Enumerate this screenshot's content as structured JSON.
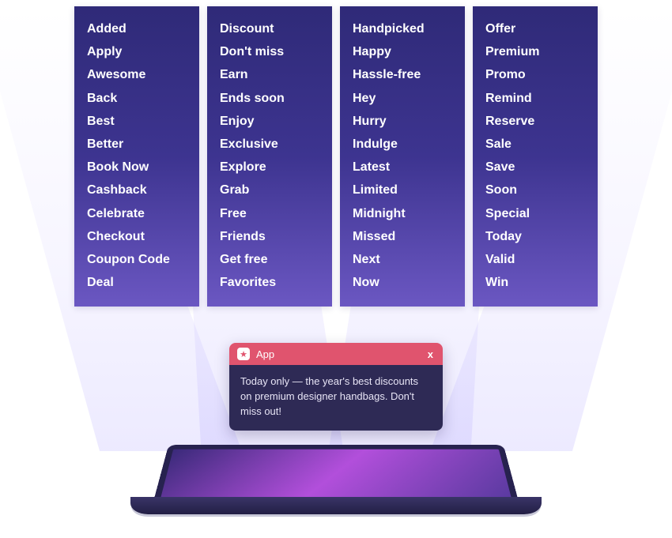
{
  "columns": [
    {
      "words": [
        "Added",
        "Apply",
        "Awesome",
        "Back",
        "Best",
        "Better",
        "Book Now",
        "Cashback",
        "Celebrate",
        "Checkout",
        "Coupon Code",
        "Deal"
      ]
    },
    {
      "words": [
        "Discount",
        "Don't miss",
        "Earn",
        "Ends soon",
        "Enjoy",
        "Exclusive",
        "Explore",
        "Grab",
        "Free",
        "Friends",
        "Get free",
        "Favorites"
      ]
    },
    {
      "words": [
        "Handpicked",
        "Happy",
        "Hassle-free",
        "Hey",
        "Hurry",
        "Indulge",
        "Latest",
        "Limited",
        "Midnight",
        "Missed",
        "Next",
        "Now"
      ]
    },
    {
      "words": [
        "Offer",
        "Premium",
        "Promo",
        "Remind",
        "Reserve",
        "Sale",
        "Save",
        "Soon",
        "Special",
        "Today",
        "Valid",
        "Win"
      ]
    }
  ],
  "notification": {
    "app_label": "App",
    "close_label": "x",
    "body": "Today only — the year's best discounts on premium designer handbags. Don't miss out!"
  }
}
